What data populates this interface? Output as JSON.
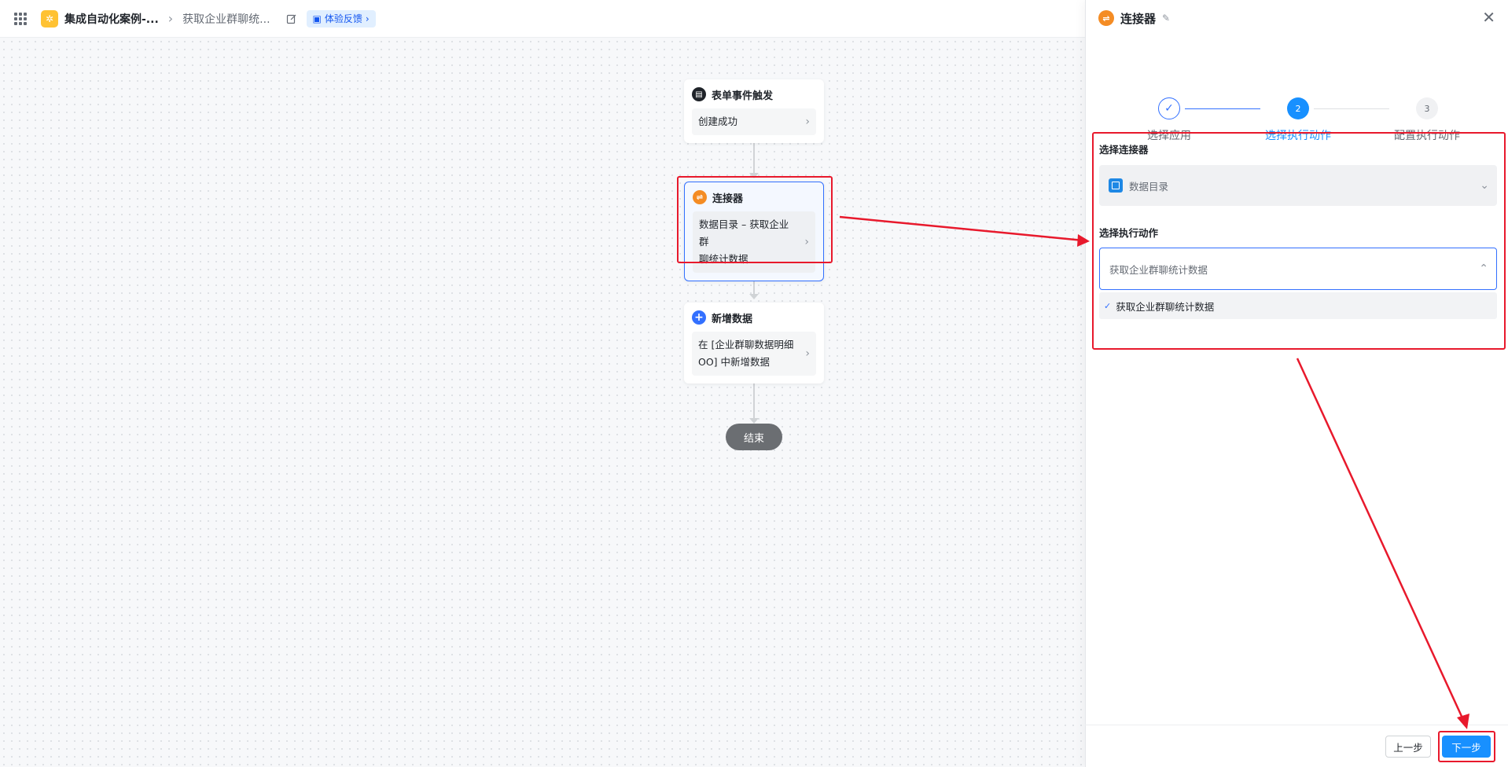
{
  "header": {
    "app_name": "集成自动化案例-...",
    "flow_name": "获取企业群聊统...",
    "feedback_label": "体验反馈"
  },
  "flow": {
    "trigger": {
      "title": "表单事件触发",
      "body": "创建成功"
    },
    "connector": {
      "title": "连接器",
      "body_line1": "数据目录 – 获取企业群",
      "body_line2": "聊统计数据"
    },
    "add_data": {
      "title": "新增数据",
      "body_line1": "在 [企业群聊数据明细",
      "body_line2": "OO] 中新增数据"
    },
    "end_label": "结束"
  },
  "panel": {
    "title": "连接器",
    "steps": [
      {
        "label": "选择应用",
        "state": "done",
        "marker": "✓"
      },
      {
        "label": "选择执行动作",
        "state": "active",
        "marker": "2"
      },
      {
        "label": "配置执行动作",
        "state": "todo",
        "marker": "3"
      }
    ],
    "connector_label": "选择连接器",
    "connector_value": "数据目录",
    "action_label": "选择执行动作",
    "action_value": "获取企业群聊统计数据",
    "option_selected": "获取企业群聊统计数据",
    "prev_button": "上一步",
    "next_button": "下一步"
  },
  "colors": {
    "primary": "#1890ff",
    "annotation_red": "#e8192c",
    "connector_orange": "#f48c24",
    "add_blue": "#3370ff"
  }
}
